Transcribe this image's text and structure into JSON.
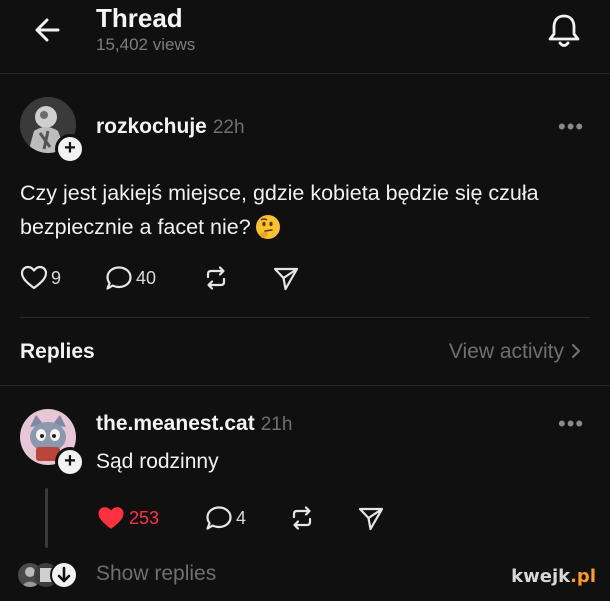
{
  "header": {
    "title": "Thread",
    "views": "15,402 views",
    "back_icon": "arrow-left-icon",
    "bell_icon": "bell-icon"
  },
  "post": {
    "username": "rozkochuje",
    "time": "22h",
    "text": "Czy jest jakiejś miejsce, gdzie kobieta będzie się czuła bezpiecznie a facet nie?",
    "emoji": "thinking-face-emoji",
    "likes": "9",
    "comments": "40"
  },
  "replies_section": {
    "label": "Replies",
    "view_activity": "View activity"
  },
  "reply": {
    "username": "the.meanest.cat",
    "time": "21h",
    "text": "Sąd rodzinny",
    "likes": "253",
    "comments": "4"
  },
  "show_replies": "Show replies",
  "watermark": {
    "main": "kwejk",
    "suffix": ".pl"
  },
  "colors": {
    "background": "#101010",
    "like_red": "#ff3040",
    "muted": "#6f6f6f"
  }
}
